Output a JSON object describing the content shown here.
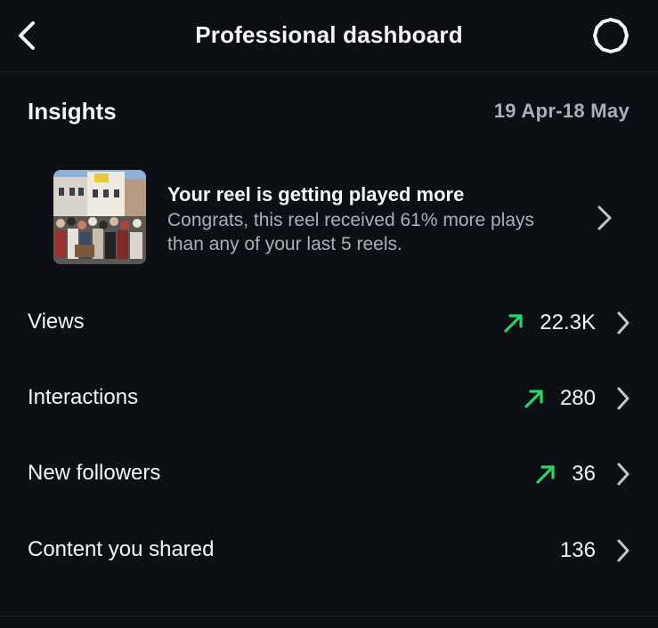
{
  "header": {
    "title": "Professional dashboard",
    "back_icon": "chevron-left-icon",
    "settings_icon": "gear-icon"
  },
  "insights": {
    "title": "Insights",
    "date_range": "19 Apr-18 May"
  },
  "reel_card": {
    "title": "Your reel is getting played more",
    "description": "Congrats, this reel received 61% more plays than any of your last 5 reels.",
    "thumbnail": "reel-thumbnail-street-crowd"
  },
  "metrics": [
    {
      "label": "Views",
      "value": "22.3K",
      "trend": "up"
    },
    {
      "label": "Interactions",
      "value": "280",
      "trend": "up"
    },
    {
      "label": "New followers",
      "value": "36",
      "trend": "up"
    },
    {
      "label": "Content you shared",
      "value": "136",
      "trend": "none"
    }
  ],
  "colors": {
    "background": "#0c1014",
    "primary_text": "#f5f5f5",
    "secondary_text": "#a8b0bb",
    "trend_up": "#2bd46b",
    "divider": "#1c2127"
  }
}
